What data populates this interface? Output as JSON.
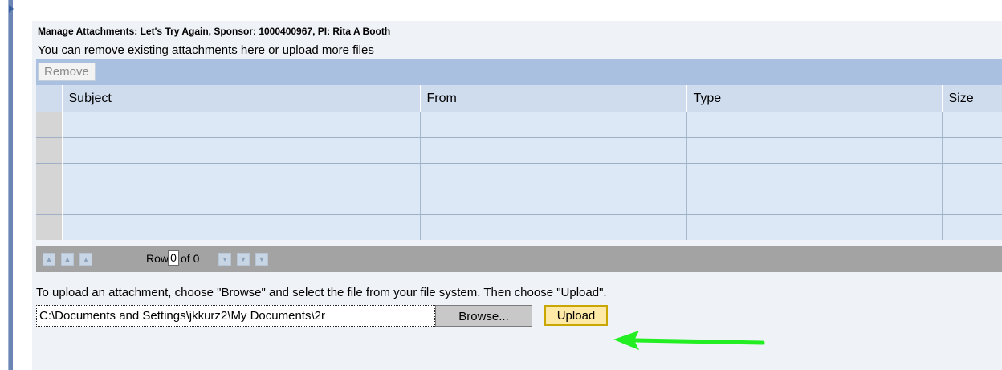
{
  "header": {
    "title": "Manage Attachments: Let's Try Again, Sponsor: 1000400967, PI: Rita A Booth",
    "subtitle": "You can remove existing attachments here or upload more files"
  },
  "toolbar": {
    "remove_label": "Remove"
  },
  "table": {
    "columns": [
      "Subject",
      "From",
      "Type",
      "Size"
    ],
    "rows": [
      [
        "",
        "",
        "",
        ""
      ],
      [
        "",
        "",
        "",
        ""
      ],
      [
        "",
        "",
        "",
        ""
      ],
      [
        "",
        "",
        "",
        ""
      ],
      [
        "",
        "",
        "",
        ""
      ]
    ]
  },
  "pager": {
    "row_label": "Row",
    "current_row": "0",
    "of_label": "of 0"
  },
  "upload": {
    "hint": "To upload an attachment, choose \"Browse\" and select the file from your file system. Then choose \"Upload\".",
    "file_path": "C:\\Documents and Settings\\jkkurz2\\My Documents\\2r",
    "browse_label": "Browse...",
    "upload_label": "Upload"
  },
  "colors": {
    "toolbar": "#a9c0e0",
    "grid_cell": "#dce8f5",
    "nav_bar": "#a3a3a3",
    "upload_button": "#ffe9a6",
    "annotation_arrow": "#22ee22"
  },
  "icons": {
    "left_expand": "triangle-right-icon",
    "pager": [
      "first-page-icon",
      "page-up-icon",
      "row-up-icon",
      "row-down-icon",
      "page-down-icon",
      "last-page-icon"
    ],
    "annotation": "arrow-left-icon"
  }
}
